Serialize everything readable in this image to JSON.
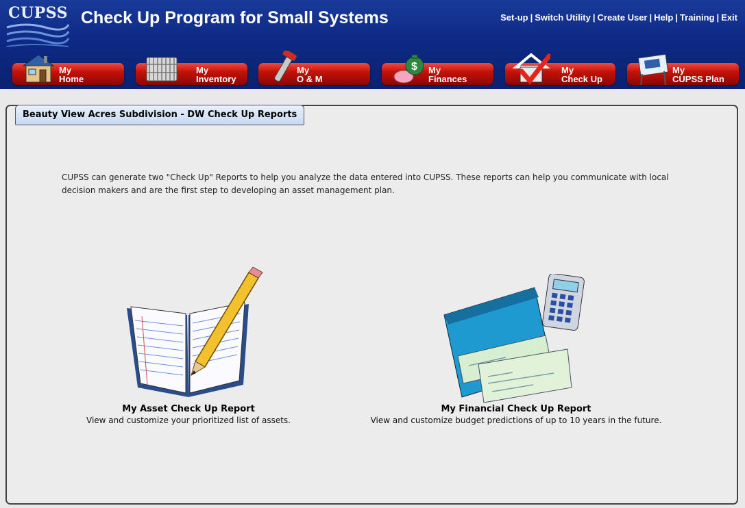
{
  "app": {
    "logo_text": "CUPSS",
    "title": "Check Up Program for Small Systems"
  },
  "top_links": [
    "Set-up",
    "Switch Utility",
    "Create User",
    "Help",
    "Training",
    "Exit"
  ],
  "nav": {
    "home": {
      "line1": "My",
      "line2": "Home",
      "icon": "house-icon"
    },
    "inventory": {
      "line1": "My",
      "line2": "Inventory",
      "icon": "pipes-stack-icon"
    },
    "om": {
      "line1": "My",
      "line2": "O & M",
      "icon": "wrench-icon"
    },
    "finances": {
      "line1": "My",
      "line2": "Finances",
      "icon": "money-bag-piggy-icon"
    },
    "checkup": {
      "line1": "My",
      "line2": "Check Up",
      "icon": "house-checkmark-icon"
    },
    "plan": {
      "line1": "My",
      "line2": "CUPSS Plan",
      "icon": "sign-board-icon"
    }
  },
  "colors": {
    "header_blue": "#0d2a84",
    "nav_red": "#c4120a",
    "panel_tab": "#c7d9f1",
    "background": "#ececec"
  },
  "panel": {
    "tab_title": "Beauty View Acres Subdivision - DW Check Up Reports",
    "intro": "CUPSS can generate two \"Check Up\" Reports to help you analyze the data entered into CUPSS. These reports can help you communicate with local decision makers and are the first step to developing an asset management plan."
  },
  "reports": {
    "asset": {
      "title": "My Asset Check Up Report",
      "description": "View and customize your prioritized list of assets.",
      "icon": "notebook-pencil-icon"
    },
    "financial": {
      "title": "My Financial Check Up Report",
      "description": "View and customize budget predictions of up to 10 years in the future.",
      "icon": "checkbook-calculator-icon"
    }
  }
}
